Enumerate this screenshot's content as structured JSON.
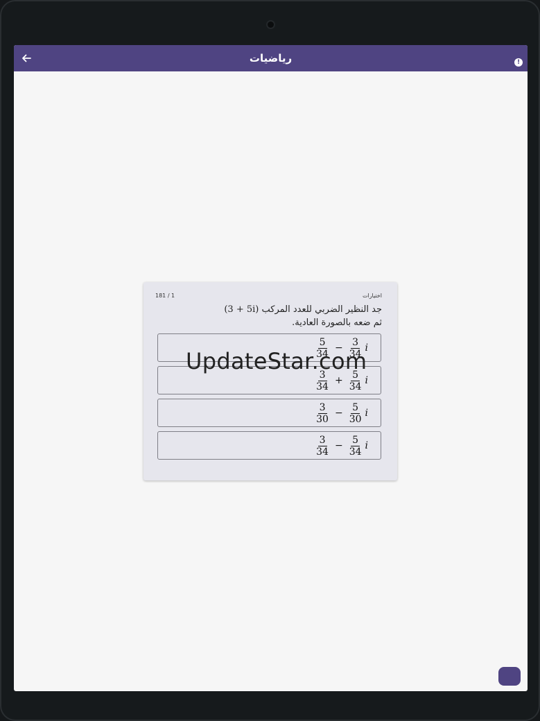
{
  "app": {
    "title": "رياضيات",
    "back_icon": "arrow-back-icon",
    "info_icon": "info-icon",
    "info_glyph": "!",
    "accent_color": "#4f4482"
  },
  "quiz": {
    "counter": "181 / 1",
    "type_label": "اختيارات",
    "question_prefix": "جد النظير الضربي للعدد المركب",
    "question_math": "(3 + 5i)",
    "question_line2": "ثم ضعه بالصورة العادية.",
    "options": [
      {
        "num1": "5",
        "den1": "34",
        "op": "−",
        "num2": "3",
        "den2": "34",
        "imag": "i"
      },
      {
        "num1": "3",
        "den1": "34",
        "op": "+",
        "num2": "5",
        "den2": "34",
        "imag": "i"
      },
      {
        "num1": "3",
        "den1": "30",
        "op": "−",
        "num2": "5",
        "den2": "30",
        "imag": "i"
      },
      {
        "num1": "3",
        "den1": "34",
        "op": "−",
        "num2": "5",
        "den2": "34",
        "imag": "i"
      }
    ]
  },
  "watermark": "UpdateStar.com"
}
